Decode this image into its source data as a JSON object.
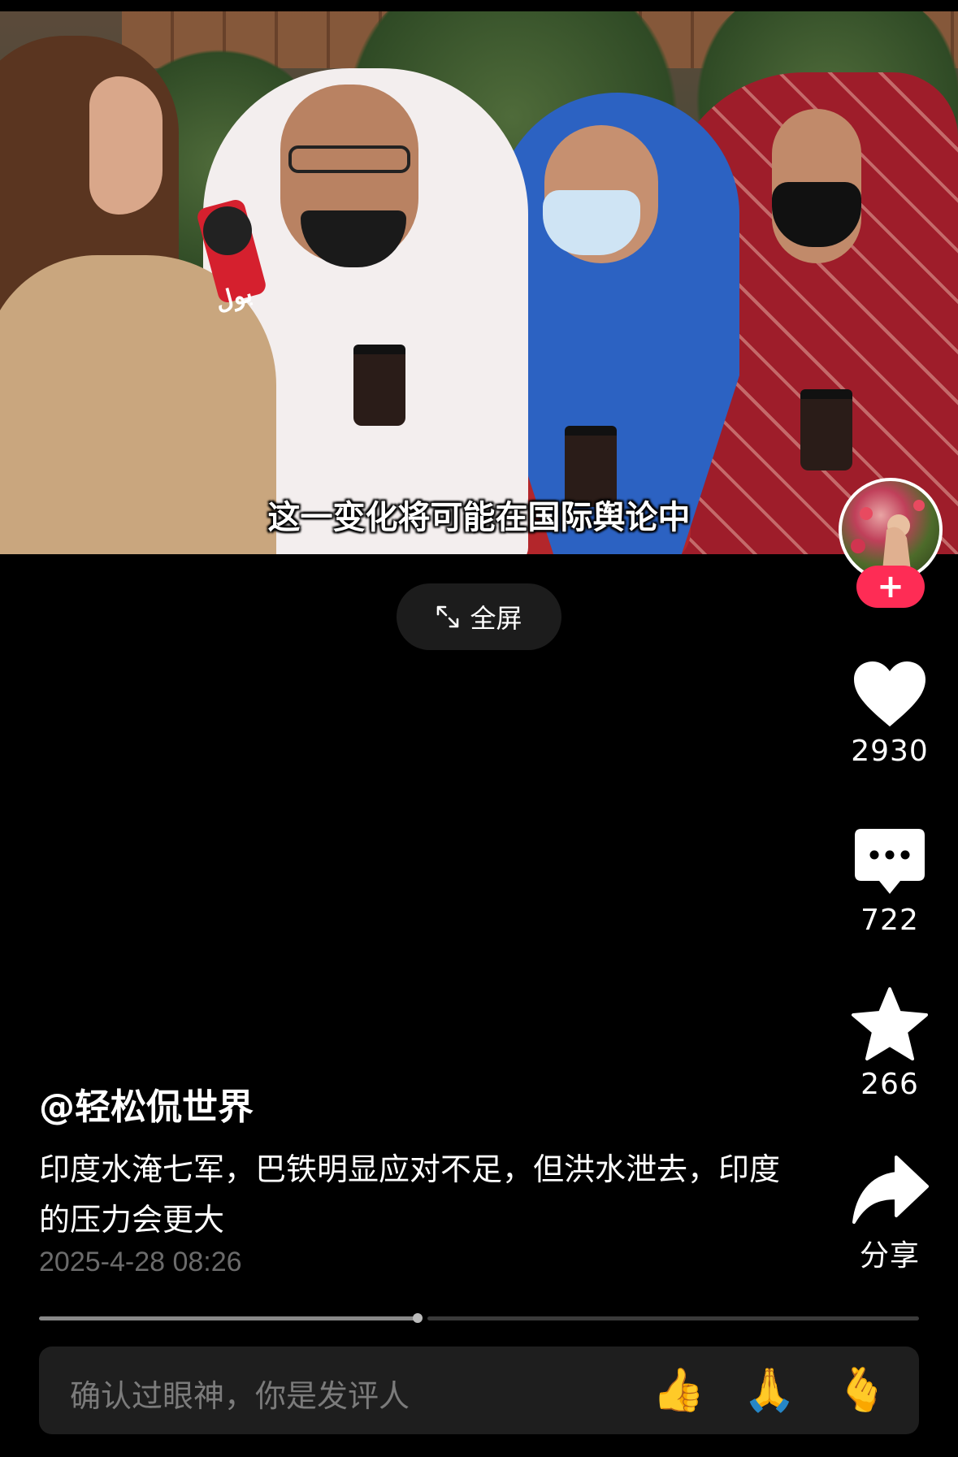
{
  "video": {
    "subtitle": "这一变化将可能在国际舆论中",
    "mic_logo": "بول"
  },
  "fullscreen": {
    "label": "全屏",
    "icon": "expand-arrows-icon"
  },
  "sidebar": {
    "avatar_icon": "creator-avatar",
    "follow_label": "+",
    "like": {
      "icon": "heart-icon",
      "count": "2930"
    },
    "comment": {
      "icon": "comment-bubble-icon",
      "count": "722"
    },
    "favorite": {
      "icon": "star-icon",
      "count": "266"
    },
    "share": {
      "icon": "share-arrow-icon",
      "label": "分享"
    }
  },
  "post": {
    "author": "@轻松侃世界",
    "description": "印度水淹七军，巴铁明显应对不足，但洪水泄去，印度的压力会更大",
    "timestamp": "2025-4-28 08:26"
  },
  "progress": {
    "played_fraction": 0.43
  },
  "comment_bar": {
    "placeholder": "确认过眼神，你是发评人",
    "emojis": [
      "👍",
      "🙏",
      "🫰"
    ]
  },
  "colors": {
    "background": "#000000",
    "accent": "#fe2c55",
    "timestamp": "#6b6b6b",
    "comment_bar": "#1e1e1e"
  }
}
